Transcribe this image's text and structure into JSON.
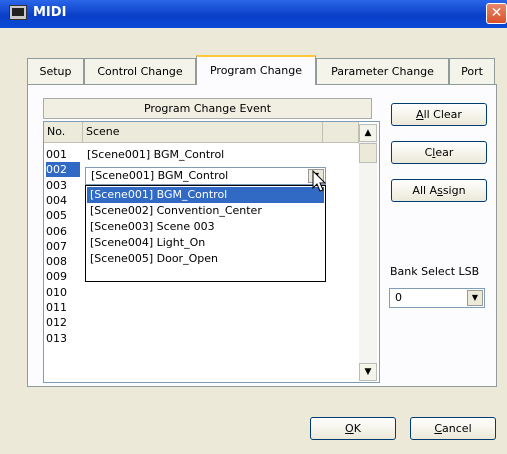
{
  "window": {
    "title": "MIDI",
    "close_glyph": "✕"
  },
  "tabs": [
    "Setup",
    "Control Change",
    "Program Change",
    "Parameter Change",
    "Port"
  ],
  "active_tab": "Program Change",
  "group": {
    "title": "Program Change Event"
  },
  "table": {
    "columns": [
      "No.",
      "Scene"
    ],
    "rows": [
      {
        "no": "001",
        "scene": "[Scene001] BGM_Control"
      },
      {
        "no": "002",
        "scene": "[Scene001] BGM_Control"
      },
      {
        "no": "003",
        "scene": ""
      },
      {
        "no": "004",
        "scene": ""
      },
      {
        "no": "005",
        "scene": ""
      },
      {
        "no": "006",
        "scene": ""
      },
      {
        "no": "007",
        "scene": ""
      },
      {
        "no": "008",
        "scene": ""
      },
      {
        "no": "009",
        "scene": ""
      },
      {
        "no": "010",
        "scene": ""
      },
      {
        "no": "011",
        "scene": ""
      },
      {
        "no": "012",
        "scene": ""
      },
      {
        "no": "013",
        "scene": ""
      }
    ],
    "selected_row": "002"
  },
  "dropdown": {
    "current_value": "[Scene001] BGM_Control",
    "options": [
      "[Scene001] BGM_Control",
      "[Scene002] Convention_Center",
      "[Scene003] Scene 003",
      "[Scene004] Light_On",
      "[Scene005] Door_Open"
    ],
    "highlighted_index": 0
  },
  "buttons": {
    "all_clear": {
      "pre": "",
      "ul": "A",
      "post": "ll Clear"
    },
    "clear": {
      "pre": "C",
      "ul": "l",
      "post": "ear"
    },
    "all_assign": {
      "pre": "All A",
      "ul": "s",
      "post": "sign"
    },
    "ok": {
      "pre": "",
      "ul": "O",
      "post": "K"
    },
    "cancel": {
      "pre": "",
      "ul": "C",
      "post": "ancel"
    }
  },
  "bank_select": {
    "label": "Bank Select LSB",
    "value": "0"
  },
  "icons": {
    "scroll_up": "▲",
    "scroll_down": "▼",
    "combo_arrow": "▼"
  },
  "colors": {
    "selection": "#316ac5",
    "titlebar": "#0a3fc8",
    "active_tab_accent": "#ffc73c"
  }
}
